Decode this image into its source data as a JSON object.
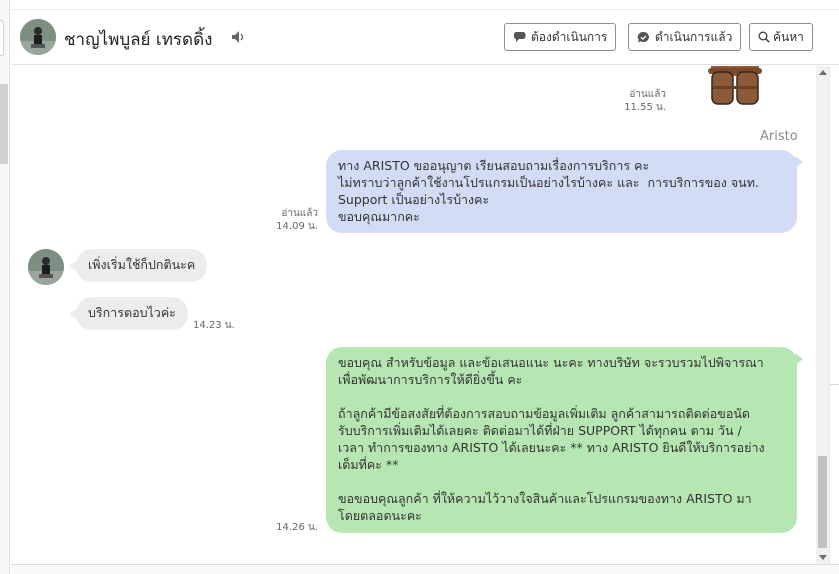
{
  "header": {
    "contact_name": "ชาญไพบูลย์ เทรดดิ้ง",
    "buttons": {
      "todo": "ต้องดำเนินการ",
      "done": "ดำเนินการแล้ว",
      "search": "ค้นหา"
    }
  },
  "messages": {
    "sticker": {
      "status": "อ่านแล้ว",
      "time": "11.55 น."
    },
    "sender_name": "Aristo",
    "m1": {
      "status": "อ่านแล้ว",
      "time": "14.09 น.",
      "lines": [
        "ทาง ARISTO ขออนุญาต เรียนสอบถามเรื่องการบริการ คะ",
        "ไม่ทราบว่าลูกค้าใช้งานโปรแกรมเป็นอย่างไรบ้างคะ และ  การบริการของ จนท.",
        "Support เป็นอย่างไรบ้างคะ",
        "ขอบคุณมากคะ"
      ]
    },
    "m2": {
      "text": "เพิ่งเริ่มใช้ก็ปกตินะค"
    },
    "m3": {
      "text": "บริการตอบไวค่ะ",
      "time": "14.23 น."
    },
    "m4": {
      "time": "14.26 น.",
      "lines": [
        "ขอบคุณ สำหรับข้อมูล และข้อเสนอแนะ นะคะ ทางบริษัท จะรวบรวมไปพิจารณา",
        "เพื่อพัฒนาการบริการให้ดียิ่งขึ้น คะ",
        "",
        "ถ้าลูกค้ามีข้อสงสัยที่ต้องการสอบถามข้อมูลเพิ่มเติม ลูกค้าสามารถติดต่อขอนัด",
        "รับบริการเพิ่มเติมได้เลยคะ ติดต่อมาได้ที่ฝ่าย SUPPORT ได้ทุกคน ตาม วัน /",
        "เวลา ทำการของทาง ARISTO ได้เลยนะคะ ** ทาง ARISTO ยินดีให้บริการอย่าง",
        "เต็มที่คะ **",
        "",
        "ขอขอบคุณลูกค้า ที่ให้ความไว้วางใจสินค้าและโปรแกรมของทาง ARISTO มา",
        "โดยตลอดนะคะ"
      ]
    }
  },
  "colors": {
    "bubble_blue": "#d3dcf5",
    "bubble_green": "#b6e6b1",
    "bubble_incoming": "#ececec"
  },
  "icons": {
    "speaker": "speaker-icon",
    "todo": "chat-bubble-icon",
    "done": "check-bubble-icon",
    "search": "search-icon"
  }
}
